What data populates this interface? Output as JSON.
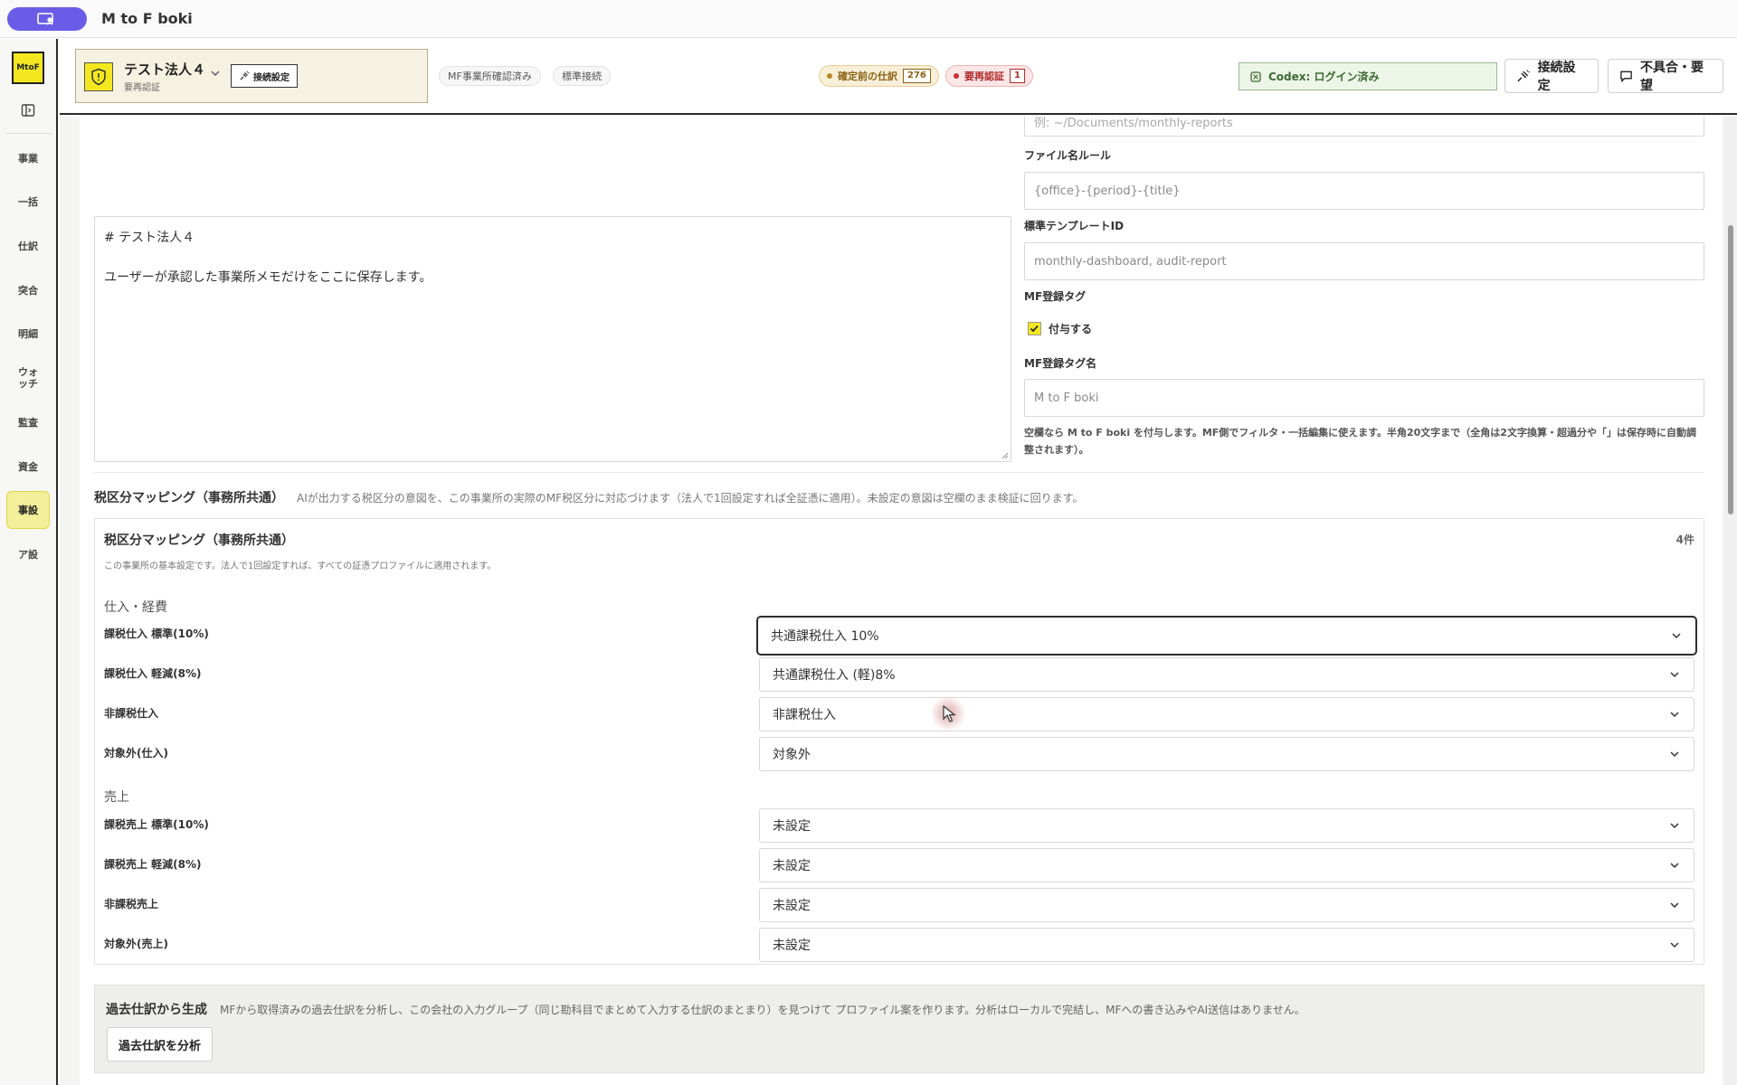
{
  "app": {
    "title": "M to F boki"
  },
  "sidebar": {
    "logo": "MtoF",
    "items": [
      {
        "label": "事業"
      },
      {
        "label": "一括"
      },
      {
        "label": "仕訳"
      },
      {
        "label": "突合"
      },
      {
        "label": "明細"
      },
      {
        "label": "ウォッチ"
      },
      {
        "label": "監査"
      },
      {
        "label": "資金"
      },
      {
        "label": "事設",
        "active": true
      },
      {
        "label": "ア設"
      }
    ]
  },
  "header": {
    "office": {
      "name": "テスト法人４",
      "status": "要再認証",
      "connect_label": "接続設定"
    },
    "chips": [
      "MF事業所確認済み",
      "標準接続"
    ],
    "pending": {
      "label": "確定前の仕訳",
      "count": "276"
    },
    "reauth": {
      "label": "要再認証",
      "count": "1"
    },
    "codex": "Codex: ログイン済み",
    "connect_button": "接続設定",
    "report_button": "不具合・要望"
  },
  "settings": {
    "folder_placeholder": "例: ~/Documents/monthly-reports",
    "filename_label": "ファイル名ルール",
    "filename_placeholder": "{office}-{period}-{title}",
    "template_label": "標準テンプレートID",
    "template_placeholder": "monthly-dashboard, audit-report",
    "tag_label": "MF登録タグ",
    "tag_checkbox_label": "付与する",
    "tag_checked": true,
    "tagname_label": "MF登録タグ名",
    "tagname_placeholder": "M to F boki",
    "tag_note": "空欄なら M to F boki を付与します。MF側でフィルタ・一括編集に使えます。半角20文字まで（全角は2文字換算・超過分や「」は保存時に自動調整されます）。"
  },
  "memo": {
    "line1": "# テスト法人４",
    "line2": "ユーザーが承認した事業所メモだけをここに保存します。"
  },
  "mapping": {
    "section_title": "税区分マッピング（事務所共通）",
    "section_desc": "AIが出力する税区分の意図を、この事業所の実際のMF税区分に対応づけます（法人で1回設定すれば全証憑に適用）。未設定の意図は空欄のまま検証に回ります。",
    "card_title": "税区分マッピング（事務所共通）",
    "card_count": "4件",
    "card_desc": "この事業所の基本設定です。法人で1回設定すれば、すべての証憑プロファイルに適用されます。",
    "purchase_group": "仕入・経費",
    "purchase_rows": [
      {
        "label": "課税仕入 標準(10%)",
        "value": "共通課税仕入 10%",
        "focused": true
      },
      {
        "label": "課税仕入 軽減(8%)",
        "value": "共通課税仕入 (軽)8%"
      },
      {
        "label": "非課税仕入",
        "value": "非課税仕入"
      },
      {
        "label": "対象外(仕入)",
        "value": "対象外"
      }
    ],
    "sales_group": "売上",
    "sales_rows": [
      {
        "label": "課税売上 標準(10%)",
        "value": "未設定"
      },
      {
        "label": "課税売上 軽減(8%)",
        "value": "未設定"
      },
      {
        "label": "非課税売上",
        "value": "未設定"
      },
      {
        "label": "対象外(売上)",
        "value": "未設定"
      }
    ]
  },
  "past": {
    "title": "過去仕訳から生成",
    "desc": "MFから取得済みの過去仕訳を分析し、この会社の入力グループ（同じ勘科目でまとめて入力する仕訳のまとまり）を見つけて プロファイル案を作ります。分析はローカルで完結し、MFへの書き込みやAI送信はありません。",
    "button": "過去仕訳を分析"
  }
}
